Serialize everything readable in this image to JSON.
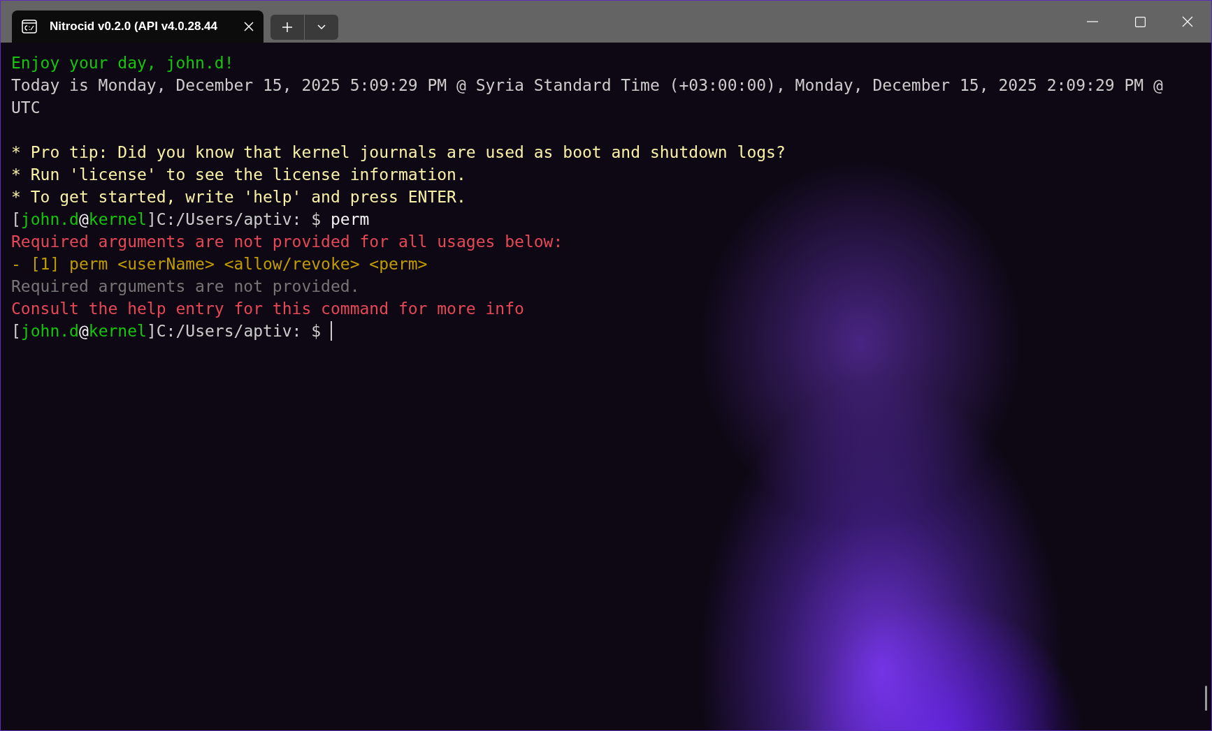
{
  "window": {
    "tab": {
      "title": "Nitrocid v0.2.0 (API v4.0.28.44",
      "selected": true
    }
  },
  "terminal": {
    "lines": [
      {
        "segments": [
          {
            "text": "Enjoy your day, john.d!",
            "color": "#16c60c"
          }
        ]
      },
      {
        "segments": [
          {
            "text": "Today is Monday, December 15, 2025 5:09:29 PM @ Syria Standard Time (+03:00:00), Monday, December 15, 2025 2:09:29 PM @",
            "color": "#cccccc"
          }
        ]
      },
      {
        "segments": [
          {
            "text": "UTC",
            "color": "#cccccc"
          }
        ]
      },
      {
        "blank_before": true,
        "segments": [
          {
            "text": "* Pro tip: Did you know that kernel journals are used as boot and shutdown logs?",
            "color": "#f9f1a5"
          }
        ]
      },
      {
        "segments": [
          {
            "text": "* Run 'license' to see the license information.",
            "color": "#f9f1a5"
          }
        ]
      },
      {
        "segments": [
          {
            "text": "* To get started, write 'help' and press ENTER.",
            "color": "#f9f1a5"
          }
        ]
      },
      {
        "segments": [
          {
            "text": "[",
            "color": "#cccccc"
          },
          {
            "text": "john.d",
            "color": "#16c60c"
          },
          {
            "text": "@",
            "color": "#f2f2f2"
          },
          {
            "text": "kernel",
            "color": "#16c60c"
          },
          {
            "text": "]C:/Users/aptiv: $ ",
            "color": "#cccccc"
          },
          {
            "text": "perm",
            "color": "#f2f2f2"
          }
        ]
      },
      {
        "segments": [
          {
            "text": "Required arguments are not provided for all usages below:",
            "color": "#e74856"
          }
        ]
      },
      {
        "segments": [
          {
            "text": "- [1] perm <userName> <allow/revoke> <perm>",
            "color": "#c19c00"
          }
        ]
      },
      {
        "segments": [
          {
            "text": "Required arguments are not provided.",
            "color": "#767676"
          }
        ]
      },
      {
        "segments": [
          {
            "text": "Consult the help entry for this command for more info",
            "color": "#e74856"
          }
        ]
      },
      {
        "segments": [
          {
            "text": "[",
            "color": "#cccccc"
          },
          {
            "text": "john.d",
            "color": "#16c60c"
          },
          {
            "text": "@",
            "color": "#f2f2f2"
          },
          {
            "text": "kernel",
            "color": "#16c60c"
          },
          {
            "text": "]C:/Users/aptiv: $ ",
            "color": "#cccccc"
          }
        ],
        "cursor": true
      }
    ]
  }
}
